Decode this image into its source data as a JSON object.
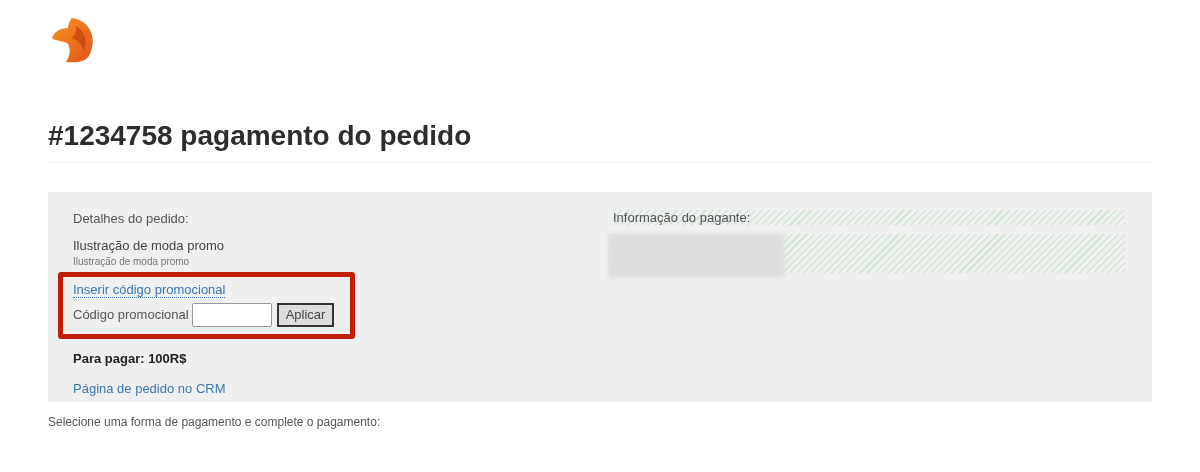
{
  "title": "#1234758 pagamento do pedido",
  "order": {
    "heading": "Detalhes do pedido:",
    "item_name": "Ilustração de moda promo",
    "item_subtitle": "Ilustração de moda promo",
    "promo": {
      "link": "Inserir código promocional",
      "label": "Código promocional",
      "button": "Aplicar",
      "highlighted": true
    },
    "total": "Para pagar: 100R$",
    "crm_link": "Página de pedido no CRM"
  },
  "payer": {
    "heading": "Informação do pagante:"
  },
  "footer_text": "Selecione uma forma de pagamento e complete o pagamento:"
}
